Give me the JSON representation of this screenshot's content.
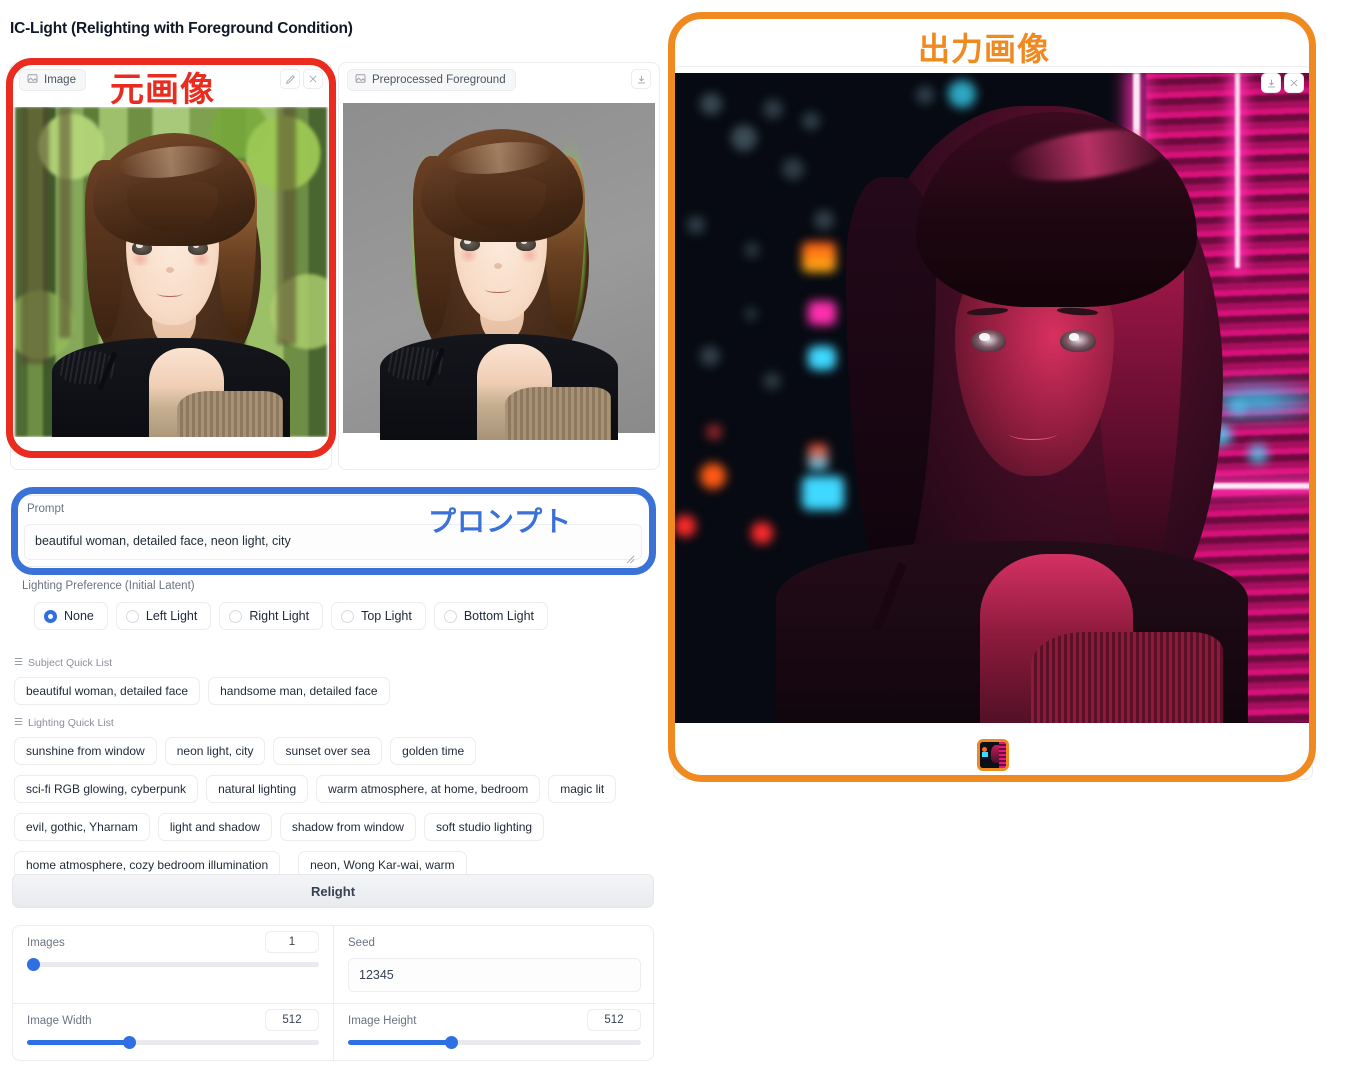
{
  "app": {
    "title": "IC-Light (Relighting with Foreground Condition)"
  },
  "annotations": {
    "source_image": "元画像",
    "prompt": "プロンプト",
    "output_image": "出力画像",
    "colors": {
      "source": "#ea2b1f",
      "prompt": "#3a72d8",
      "output": "#ef8a21"
    }
  },
  "source_image_panel": {
    "header_label": "Image",
    "header_icon": "image-icon",
    "edit_icon": "pencil-icon",
    "clear_icon": "close-icon"
  },
  "foreground_panel": {
    "header_label": "Preprocessed Foreground",
    "header_icon": "image-icon",
    "download_icon": "download-icon"
  },
  "output_panel": {
    "download_icon": "download-icon",
    "close_icon": "close-icon",
    "thumbnail_selected": true
  },
  "prompt": {
    "label": "Prompt",
    "value": "beautiful woman, detailed face, neon light, city",
    "placeholder": ""
  },
  "lighting_preference": {
    "label": "Lighting Preference (Initial Latent)",
    "selected": "None",
    "options": [
      "None",
      "Left Light",
      "Right Light",
      "Top Light",
      "Bottom Light"
    ]
  },
  "subject_quick_list": {
    "label": "Subject Quick List",
    "icon": "list-icon",
    "items": [
      "beautiful woman, detailed face",
      "handsome man, detailed face"
    ]
  },
  "lighting_quick_list": {
    "label": "Lighting Quick List",
    "icon": "list-icon",
    "items": [
      "sunshine from window",
      "neon light, city",
      "sunset over sea",
      "golden time",
      "sci-fi RGB glowing, cyberpunk",
      "natural lighting",
      "warm atmosphere, at home, bedroom",
      "magic lit",
      "evil, gothic, Yharnam",
      "light and shadow",
      "shadow from window",
      "soft studio lighting",
      "home atmosphere, cozy bedroom illumination",
      "neon, Wong Kar-wai, warm"
    ]
  },
  "relight_button": {
    "label": "Relight"
  },
  "params": {
    "images": {
      "label": "Images",
      "value": "1",
      "percent": 2
    },
    "seed": {
      "label": "Seed",
      "value": "12345"
    },
    "image_width": {
      "label": "Image Width",
      "value": "512",
      "percent": 35
    },
    "image_height": {
      "label": "Image Height",
      "value": "512",
      "percent": 35
    }
  }
}
